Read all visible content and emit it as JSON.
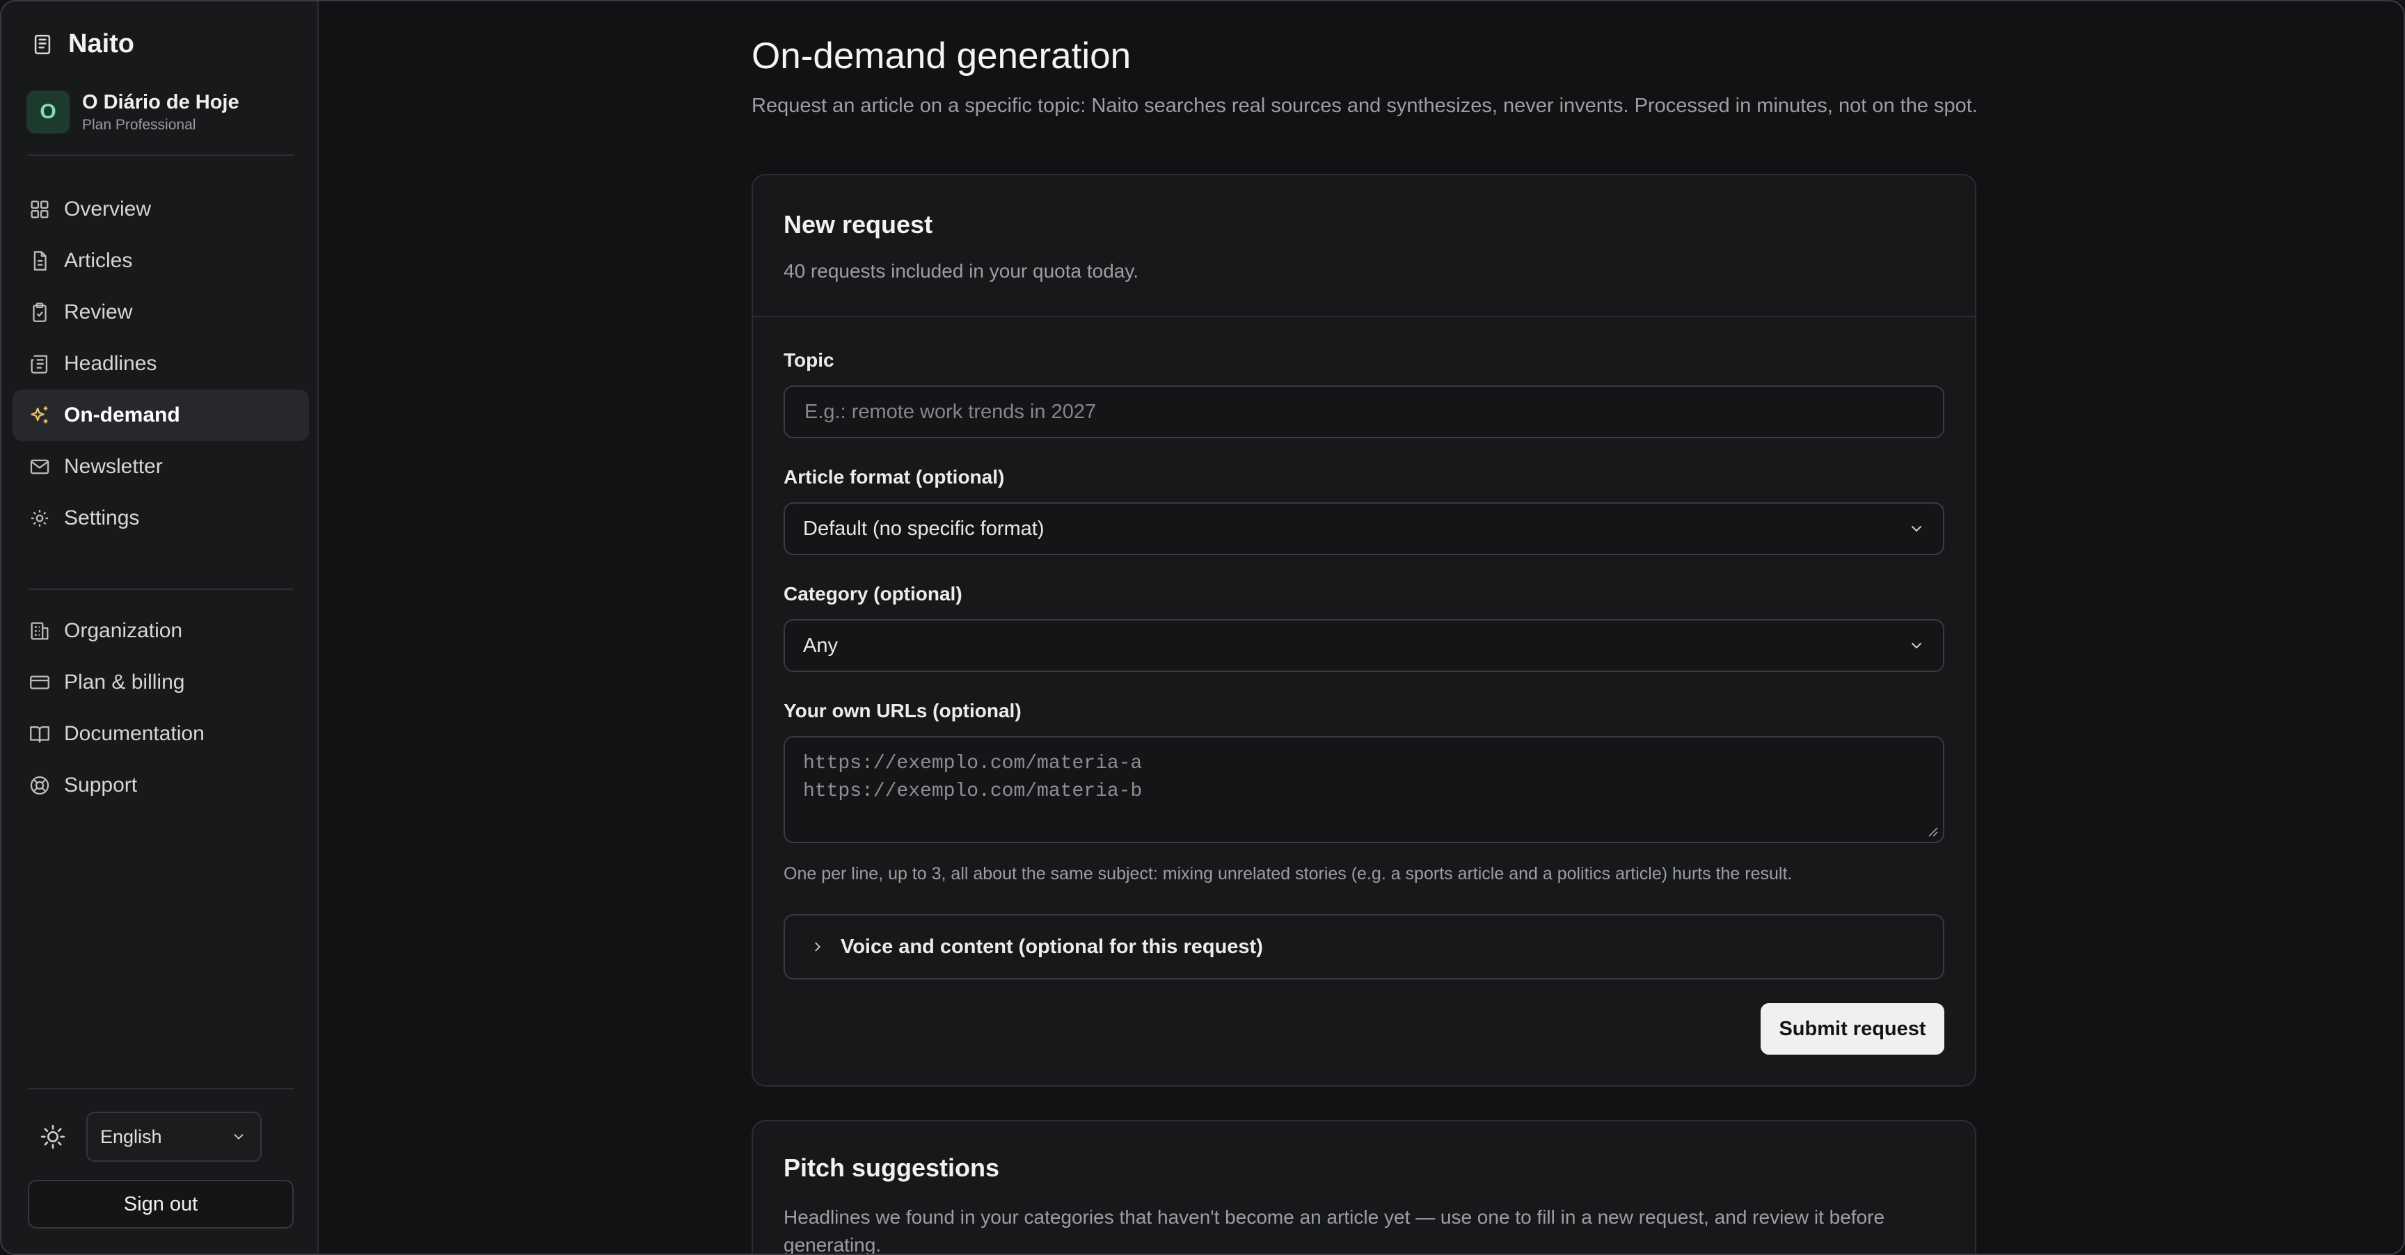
{
  "app": {
    "name": "Naito"
  },
  "organization": {
    "initial": "O",
    "name": "O Diário de Hoje",
    "plan": "Plan Professional"
  },
  "nav": {
    "primary": [
      {
        "label": "Overview",
        "icon": "grid-icon"
      },
      {
        "label": "Articles",
        "icon": "file-icon"
      },
      {
        "label": "Review",
        "icon": "clipboard-check-icon"
      },
      {
        "label": "Headlines",
        "icon": "newspaper-icon"
      },
      {
        "label": "On-demand",
        "icon": "sparkles-icon",
        "active": true
      },
      {
        "label": "Newsletter",
        "icon": "mail-icon"
      },
      {
        "label": "Settings",
        "icon": "gear-icon"
      }
    ],
    "secondary": [
      {
        "label": "Organization",
        "icon": "building-icon"
      },
      {
        "label": "Plan & billing",
        "icon": "credit-card-icon"
      },
      {
        "label": "Documentation",
        "icon": "book-icon"
      },
      {
        "label": "Support",
        "icon": "life-buoy-icon"
      }
    ]
  },
  "footer": {
    "language": "English",
    "sign_out": "Sign out"
  },
  "page": {
    "title": "On-demand generation",
    "subtitle": "Request an article on a specific topic: Naito searches real sources and synthesizes, never invents. Processed in minutes, not on the spot."
  },
  "request_form": {
    "title": "New request",
    "quota": "40 requests included in your quota today.",
    "topic": {
      "label": "Topic",
      "placeholder": "E.g.: remote work trends in 2027"
    },
    "format": {
      "label": "Article format (optional)",
      "value": "Default (no specific format)"
    },
    "category": {
      "label": "Category (optional)",
      "value": "Any"
    },
    "urls": {
      "label": "Your own URLs (optional)",
      "placeholder_lines": [
        "https://exemplo.com/materia-a",
        "https://exemplo.com/materia-b"
      ],
      "hint": "One per line, up to 3, all about the same subject: mixing unrelated stories (e.g. a sports article and a politics article) hurts the result."
    },
    "voice_section": "Voice and content (optional for this request)",
    "submit": "Submit request"
  },
  "pitch": {
    "title": "Pitch suggestions",
    "description": "Headlines we found in your categories that haven't become an article yet — use one to fill in a new request, and review it before generating."
  },
  "colors": {
    "accent_active_icon": "#e8b86a",
    "org_avatar_bg": "#1c3a2e",
    "org_avatar_fg": "#7fe0b0"
  }
}
